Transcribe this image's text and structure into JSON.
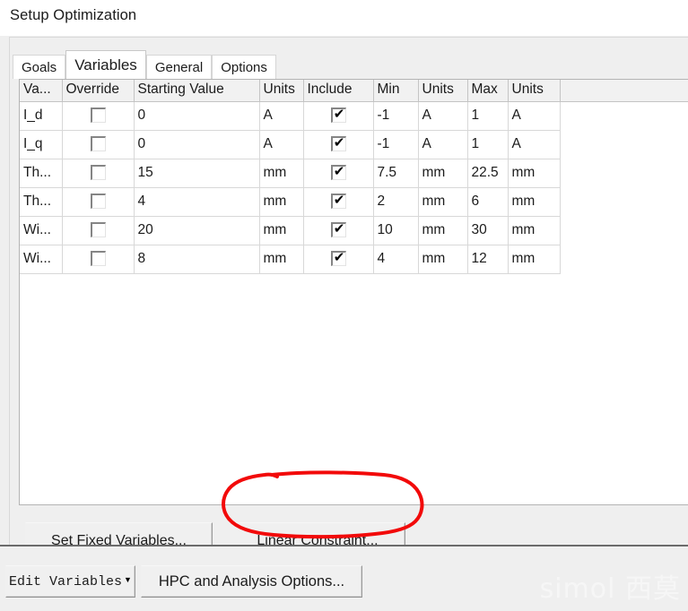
{
  "window": {
    "title": "Setup Optimization"
  },
  "tabs": [
    {
      "label": "Goals",
      "active": false
    },
    {
      "label": "Variables",
      "active": true
    },
    {
      "label": "General",
      "active": false
    },
    {
      "label": "Options",
      "active": false
    }
  ],
  "table": {
    "columns": [
      "Va...",
      "Override",
      "Starting Value",
      "Units",
      "Include",
      "Min",
      "Units",
      "Max",
      "Units",
      ""
    ],
    "rows": [
      {
        "variable": "I_d",
        "override": false,
        "starting_value": "0",
        "start_units": "A",
        "include": true,
        "min": "-1",
        "min_units": "A",
        "max": "1",
        "max_units": "A"
      },
      {
        "variable": "I_q",
        "override": false,
        "starting_value": "0",
        "start_units": "A",
        "include": true,
        "min": "-1",
        "min_units": "A",
        "max": "1",
        "max_units": "A"
      },
      {
        "variable": "Th...",
        "override": false,
        "starting_value": "15",
        "start_units": "mm",
        "include": true,
        "min": "7.5",
        "min_units": "mm",
        "max": "22.5",
        "max_units": "mm"
      },
      {
        "variable": "Th...",
        "override": false,
        "starting_value": "4",
        "start_units": "mm",
        "include": true,
        "min": "2",
        "min_units": "mm",
        "max": "6",
        "max_units": "mm"
      },
      {
        "variable": "Wi...",
        "override": false,
        "starting_value": "20",
        "start_units": "mm",
        "include": true,
        "min": "10",
        "min_units": "mm",
        "max": "30",
        "max_units": "mm"
      },
      {
        "variable": "Wi...",
        "override": false,
        "starting_value": "8",
        "start_units": "mm",
        "include": true,
        "min": "4",
        "min_units": "mm",
        "max": "12",
        "max_units": "mm"
      }
    ],
    "checked_glyph": "✔",
    "unchecked_glyph": ""
  },
  "buttons": {
    "set_fixed_variables": "Set Fixed Variables...",
    "linear_constraint": "Linear Constraint..."
  },
  "footer": {
    "edit_variables": "Edit Variables",
    "edit_variables_caret": "▼",
    "hpc_and_analysis_options": "HPC and Analysis Options..."
  },
  "watermark": {
    "text": "simol 西莫"
  },
  "annotation": {
    "color": "#f20a0a",
    "shape": "hand-drawn-ellipse",
    "target": "Linear Constraint..."
  },
  "colors": {
    "dialog_background": "#efefef",
    "table_background": "#ffffff",
    "header_background": "#f1f1f1",
    "text": "#1b1b1b",
    "annotation_red": "#f20a0a"
  }
}
